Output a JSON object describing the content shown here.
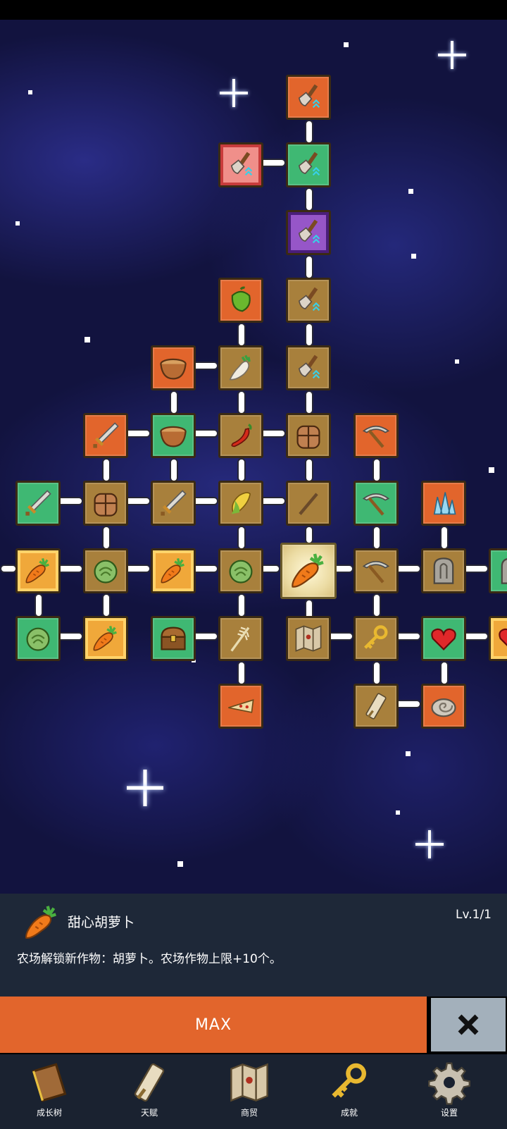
{
  "nodes": [
    {
      "name": "shovel",
      "color": "orange"
    },
    {
      "name": "shovel",
      "color": "green"
    },
    {
      "name": "shovel",
      "color": "pink"
    },
    {
      "name": "shovel",
      "color": "purple"
    },
    {
      "name": "pepper",
      "color": "orange"
    },
    {
      "name": "shovel",
      "color": "gold"
    },
    {
      "name": "bowl",
      "color": "orange"
    },
    {
      "name": "radish",
      "color": "gold"
    },
    {
      "name": "shovel",
      "color": "gold"
    },
    {
      "name": "sword",
      "color": "orange"
    },
    {
      "name": "bowl",
      "color": "green"
    },
    {
      "name": "chili",
      "color": "gold"
    },
    {
      "name": "backpack",
      "color": "gold"
    },
    {
      "name": "pickaxe",
      "color": "orange"
    },
    {
      "name": "sword",
      "color": "green"
    },
    {
      "name": "backpack",
      "color": "gold"
    },
    {
      "name": "sword",
      "color": "gold"
    },
    {
      "name": "corn",
      "color": "gold"
    },
    {
      "name": "stick",
      "color": "gold"
    },
    {
      "name": "pickaxe",
      "color": "green"
    },
    {
      "name": "crystal",
      "color": "orange"
    },
    {
      "name": "carrot",
      "color": "yellowc"
    },
    {
      "name": "cabbage",
      "color": "gold"
    },
    {
      "name": "carrot",
      "color": "yellowc"
    },
    {
      "name": "cabbage",
      "color": "gold"
    },
    {
      "name": "carrot",
      "color": "center"
    },
    {
      "name": "pickaxe",
      "color": "gold"
    },
    {
      "name": "tombstone",
      "color": "gold"
    },
    {
      "name": "tombstone",
      "color": "green"
    },
    {
      "name": "cabbage",
      "color": "green"
    },
    {
      "name": "carrot",
      "color": "yellowc"
    },
    {
      "name": "chest",
      "color": "green"
    },
    {
      "name": "wheat",
      "color": "gold"
    },
    {
      "name": "map",
      "color": "gold"
    },
    {
      "name": "key",
      "color": "gold"
    },
    {
      "name": "heart",
      "color": "green"
    },
    {
      "name": "heart",
      "color": "yellowc"
    },
    {
      "name": "pizza",
      "color": "orange"
    },
    {
      "name": "scroll",
      "color": "gold"
    },
    {
      "name": "fossil",
      "color": "orange"
    }
  ],
  "detail": {
    "icon": "carrot-icon",
    "title": "甜心胡萝卜",
    "level": "Lv.1/1",
    "description": "农场解锁新作物：胡萝卜。农场作物上限+10个。"
  },
  "actions": {
    "max_label": "MAX",
    "close_icon": "close-icon"
  },
  "nav": [
    {
      "label": "成长树",
      "icon": "book-icon"
    },
    {
      "label": "天赋",
      "icon": "scroll-icon"
    },
    {
      "label": "商贸",
      "icon": "map-icon"
    },
    {
      "label": "成就",
      "icon": "key-icon"
    },
    {
      "label": "设置",
      "icon": "gear-icon"
    }
  ],
  "colors": {
    "orange": "#e2652c",
    "green": "#3fb873",
    "gold": "#a8803c",
    "panel": "#1e2838",
    "close_button": "#a3b0bb"
  }
}
